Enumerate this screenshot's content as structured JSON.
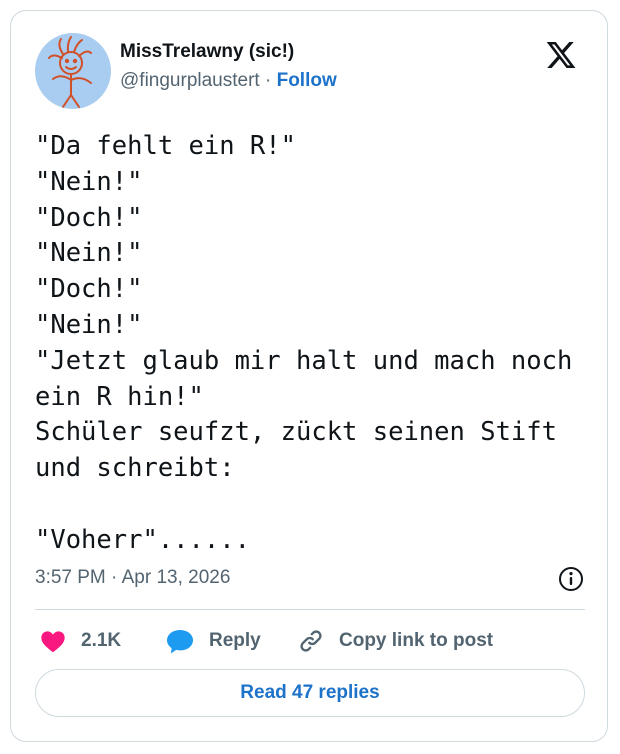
{
  "author": {
    "display_name": "MissTrelawny (sic!)",
    "handle": "@fingurplaustert",
    "separator": "·",
    "follow_label": "Follow",
    "avatar_icon": "stick-figure-avatar-icon",
    "avatar_bg": "#a9cdf0"
  },
  "tweet": {
    "text": "\"Da fehlt ein R!\"\n\"Nein!\"\n\"Doch!\"\n\"Nein!\"\n\"Doch!\"\n\"Nein!\"\n\"Jetzt glaub mir halt und mach noch ein R hin!\"\nSchüler seufzt, zückt seinen Stift und schreibt:\n\n\"Voherr\"......",
    "timestamp": "3:57 PM · Apr 13, 2026"
  },
  "actions": {
    "like_count": "2.1K",
    "reply_label": "Reply",
    "copy_label": "Copy link to post"
  },
  "read_replies_label": "Read 47 replies",
  "colors": {
    "accent": "#1d72c9",
    "like": "#f91880",
    "reply_bubble": "#1d9bf0",
    "secondary_text": "#536471",
    "border": "#cfd9de"
  }
}
